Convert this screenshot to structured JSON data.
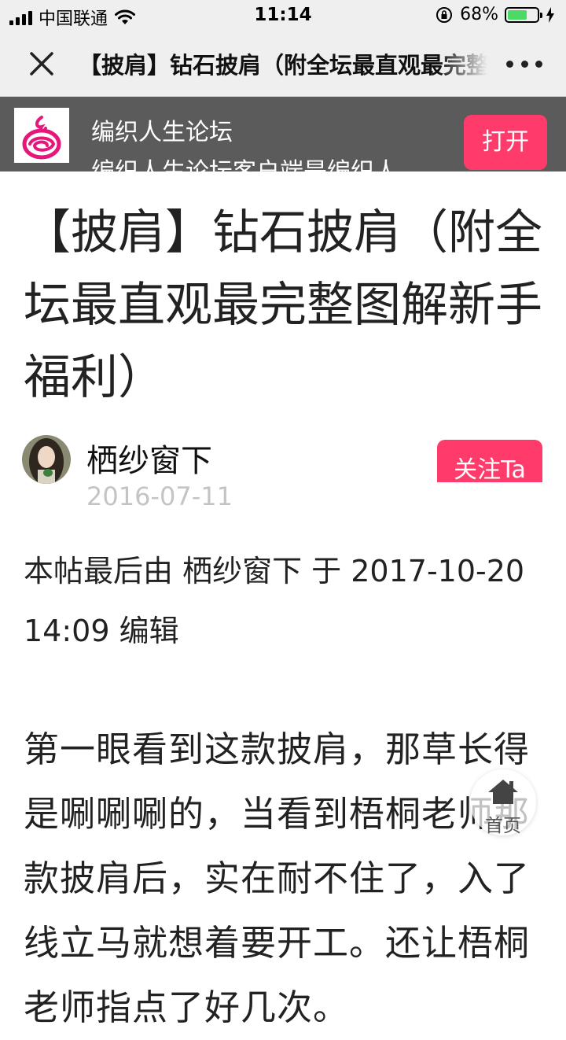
{
  "status_bar": {
    "carrier": "中国联通",
    "time": "11:14",
    "battery_percent": "68%",
    "battery_level": 0.68,
    "icons": [
      "signal-icon",
      "wifi-icon",
      "rotation-lock-icon",
      "battery-icon",
      "charging-icon"
    ]
  },
  "nav": {
    "title": "【披肩】钻石披肩（附全坛最直观最完整图解新手福利）",
    "close_icon": "close-icon",
    "more_icon": "more-icon"
  },
  "app_banner": {
    "name": "编织人生论坛",
    "description": "编织人生论坛客户端是编织人...",
    "open_label": "打开",
    "accent_color": "#ff3b6b"
  },
  "post": {
    "title": "【披肩】钻石披肩（附全坛最直观最完整图解新手福利）",
    "author": "栖纱窗下",
    "date": "2016-07-11",
    "follow_label": "关注Ta",
    "edit_note": "本帖最后由 栖纱窗下 于 2017-10-20 14:09 编辑",
    "body": "第一眼看到这款披肩，那草长得是唰唰唰的，当看到梧桐老师那款披肩后，实在耐不住了，入了线立马就想着要开工。还让梧桐老师指点了好几次。"
  },
  "floating": {
    "home_label": "首页"
  }
}
